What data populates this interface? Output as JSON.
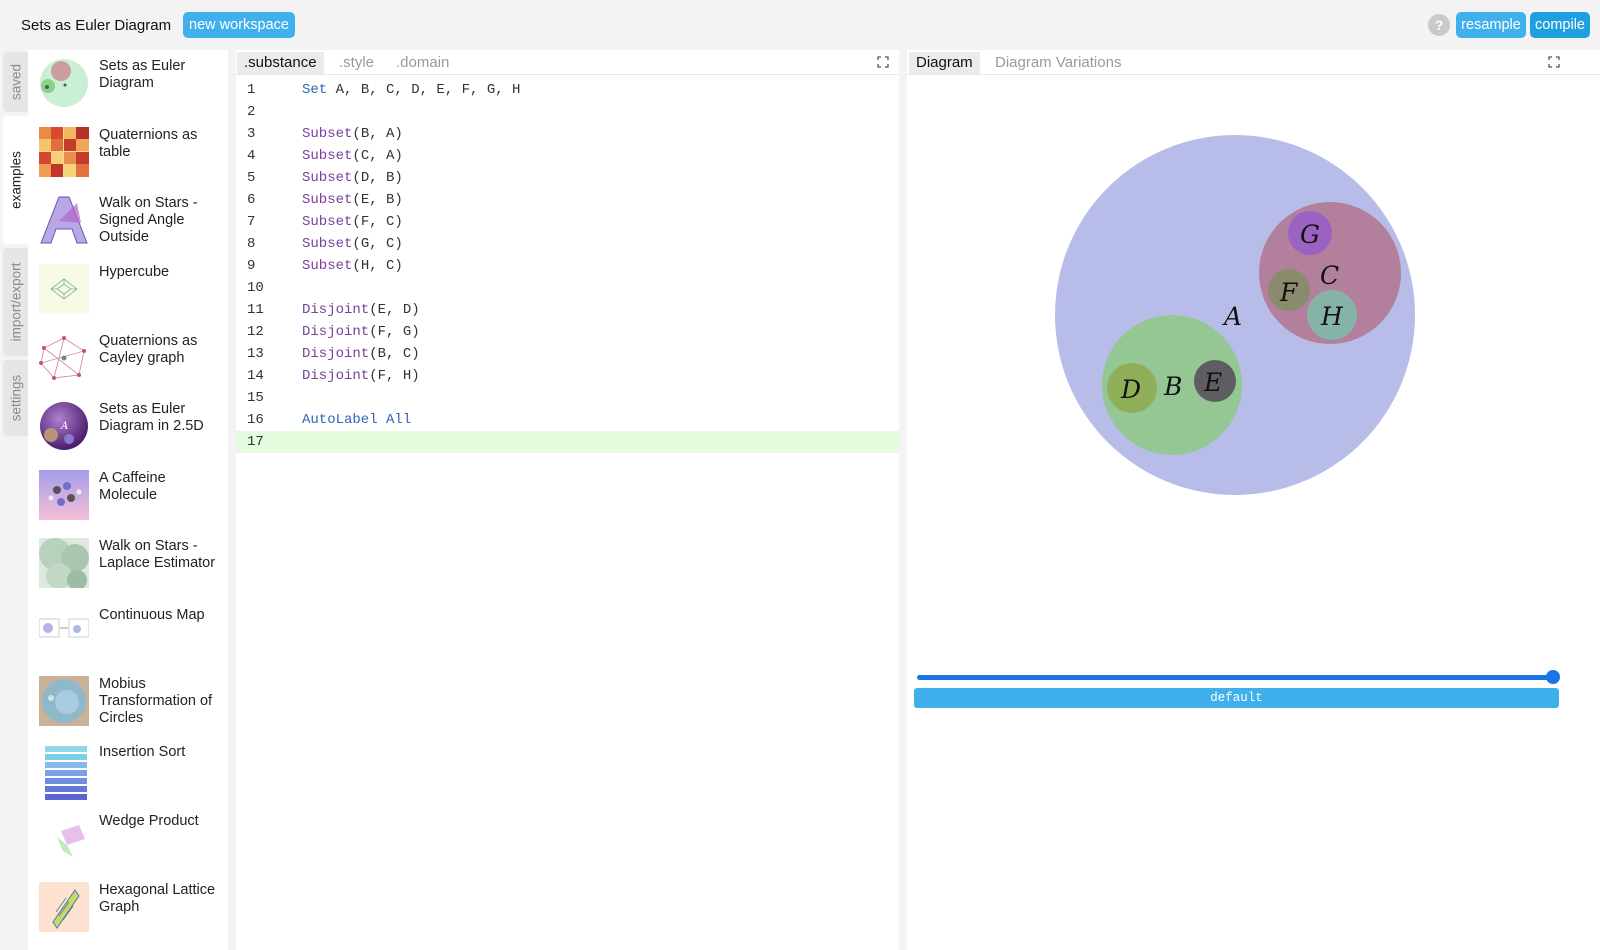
{
  "topbar": {
    "title": "Sets as Euler Diagram",
    "new_workspace": "new workspace",
    "help": "?",
    "resample": "resample",
    "compile": "compile"
  },
  "vtabs": [
    "saved",
    "examples",
    "import/export",
    "settings"
  ],
  "examples": [
    "Sets as Euler Diagram",
    "Quaternions as table",
    "Walk on Stars - Signed Angle Outside",
    "Hypercube",
    "Quaternions as Cayley graph",
    "Sets as Euler Diagram in 2.5D",
    "A Caffeine Molecule",
    "Walk on Stars - Laplace Estimator",
    "Continuous Map",
    "Mobius Transformation of Circles",
    "Insertion Sort",
    "Wedge Product",
    "Hexagonal Lattice Graph"
  ],
  "editor": {
    "tabs": [
      ".substance",
      ".style",
      ".domain"
    ],
    "lines": [
      {
        "n": "1",
        "kw": "Set",
        "rest": " A, B, C, D, E, F, G, H"
      },
      {
        "n": "2",
        "kw": "",
        "rest": ""
      },
      {
        "n": "3",
        "fn": "Subset",
        "rest": "(B, A)"
      },
      {
        "n": "4",
        "fn": "Subset",
        "rest": "(C, A)"
      },
      {
        "n": "5",
        "fn": "Subset",
        "rest": "(D, B)"
      },
      {
        "n": "6",
        "fn": "Subset",
        "rest": "(E, B)"
      },
      {
        "n": "7",
        "fn": "Subset",
        "rest": "(F, C)"
      },
      {
        "n": "8",
        "fn": "Subset",
        "rest": "(G, C)"
      },
      {
        "n": "9",
        "fn": "Subset",
        "rest": "(H, C)"
      },
      {
        "n": "10",
        "kw": "",
        "rest": ""
      },
      {
        "n": "11",
        "fn": "Disjoint",
        "rest": "(E, D)"
      },
      {
        "n": "12",
        "fn": "Disjoint",
        "rest": "(F, G)"
      },
      {
        "n": "13",
        "fn": "Disjoint",
        "rest": "(B, C)"
      },
      {
        "n": "14",
        "fn": "Disjoint",
        "rest": "(F, H)"
      },
      {
        "n": "15",
        "kw": "",
        "rest": ""
      },
      {
        "n": "16",
        "kw": "AutoLabel All",
        "rest": ""
      },
      {
        "n": "17",
        "kw": "",
        "rest": ""
      }
    ]
  },
  "right": {
    "tabs": [
      "Diagram",
      "Diagram Variations"
    ],
    "variation": "default",
    "labels": {
      "A": "A",
      "B": "B",
      "C": "C",
      "D": "D",
      "E": "E",
      "F": "F",
      "G": "G",
      "H": "H"
    }
  },
  "colors": {
    "accent": "#40b0ed",
    "A": "#b8bce8",
    "B": "#94c794",
    "C": "#b27f9c",
    "D": "#8fae58",
    "E": "#5d5d62",
    "F": "#8a8a6c",
    "G": "#9b62c1",
    "H": "#86b3a8"
  }
}
